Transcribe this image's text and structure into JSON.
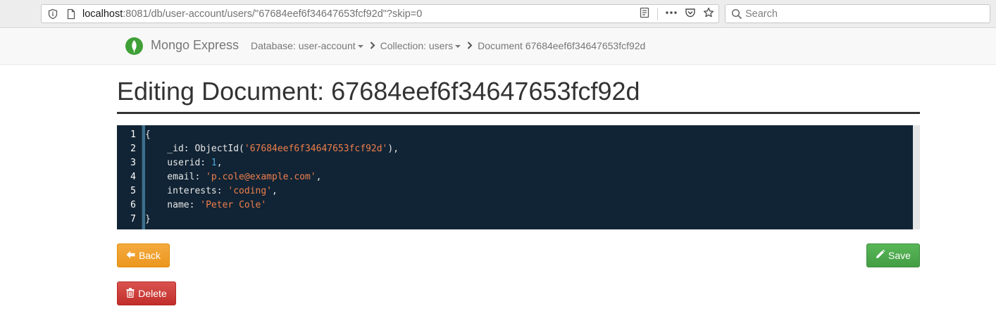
{
  "browser": {
    "url_host": "localhost",
    "url_rest": ":8081/db/user-account/users/\"67684eef6f34647653fcf92d\"?skip=0",
    "search_placeholder": "Search"
  },
  "navbar": {
    "brand": "Mongo Express",
    "breadcrumbs": [
      {
        "label": "Database: user-account"
      },
      {
        "label": "Collection: users"
      },
      {
        "label": "Document 67684eef6f34647653fcf92d"
      }
    ]
  },
  "page": {
    "title": "Editing Document: 67684eef6f34647653fcf92d"
  },
  "editor": {
    "line_numbers": [
      "1",
      "2",
      "3",
      "4",
      "5",
      "6",
      "7"
    ],
    "lines": {
      "l1": "{",
      "l2_key": "    _id: ObjectId(",
      "l2_val": "'67684eef6f34647653fcf92d'",
      "l2_end": "),",
      "l3_key": "    userid: ",
      "l3_val": "1",
      "l3_end": ",",
      "l4_key": "    email: ",
      "l4_val": "'p.cole@example.com'",
      "l4_end": ",",
      "l5_key": "    interests: ",
      "l5_val": "'coding'",
      "l5_end": ",",
      "l6_key": "    name: ",
      "l6_val": "'Peter Cole'",
      "l7": "}"
    }
  },
  "buttons": {
    "back": "Back",
    "save": "Save",
    "delete": "Delete"
  },
  "colors": {
    "back": "#ec971f",
    "save": "#449d44",
    "delete": "#c9302c",
    "editor_bg": "#112435",
    "string": "#ef7e4b",
    "number": "#4ea6dc"
  }
}
